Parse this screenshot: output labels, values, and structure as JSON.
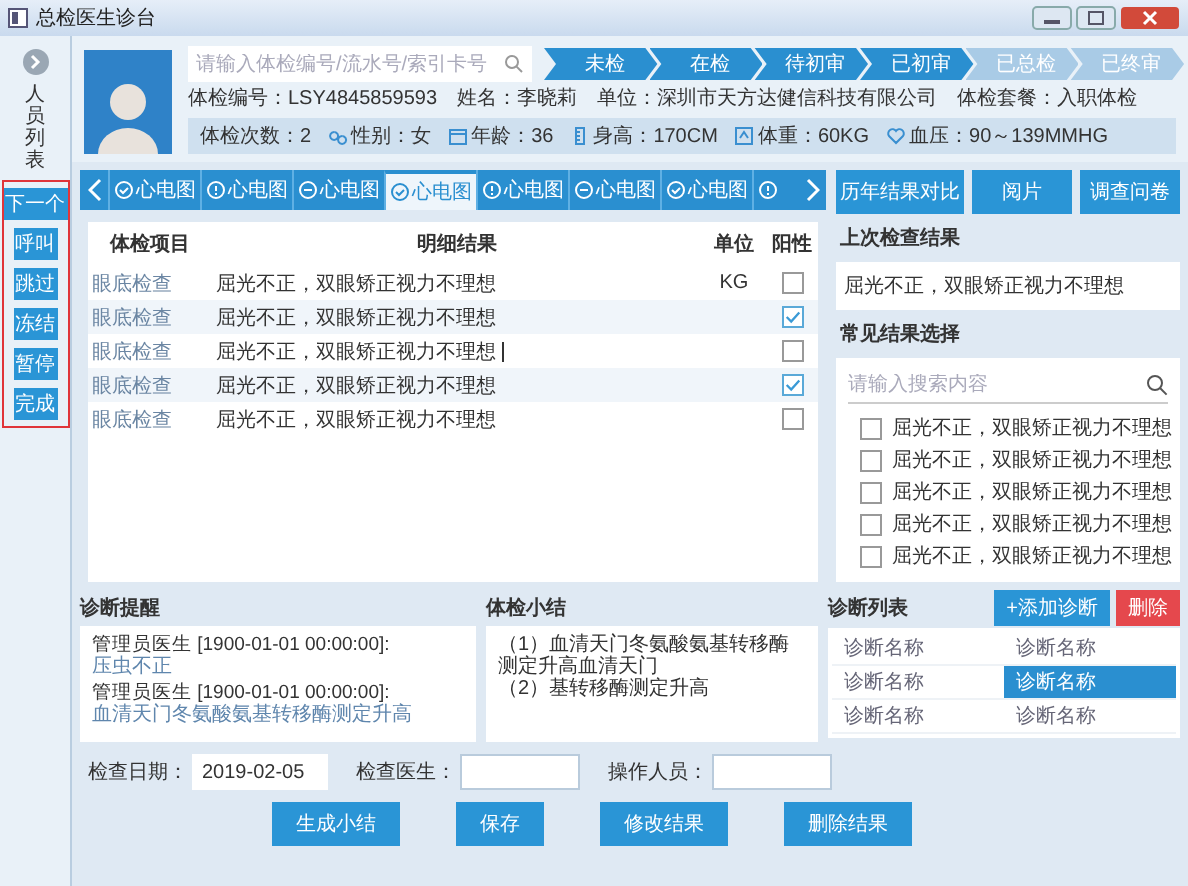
{
  "window": {
    "title": "总检医生诊台"
  },
  "sidebar": {
    "label": "人员列表",
    "actions": [
      "下一个",
      "呼叫",
      "跳过",
      "冻结",
      "暂停",
      "完成"
    ]
  },
  "search": {
    "placeholder": "请输入体检编号/流水号/索引卡号"
  },
  "steps": [
    {
      "label": "未检",
      "done": true
    },
    {
      "label": "在检",
      "done": true
    },
    {
      "label": "待初审",
      "done": true
    },
    {
      "label": "已初审",
      "done": true
    },
    {
      "label": "已总检",
      "done": false
    },
    {
      "label": "已终审",
      "done": false
    }
  ],
  "patient": {
    "info": [
      "体检编号：LSY4845859593",
      "姓名：李晓莉",
      "单位：深圳市天方达健信科技有限公司",
      "体检套餐：入职体检"
    ],
    "stats": [
      "体检次数：2",
      "性别：女",
      "年龄：36",
      "身高：170CM",
      "体重：60KG",
      "血压：90～139MMHG"
    ]
  },
  "tabs": [
    {
      "label": "心电图",
      "kind": "done",
      "selected": false
    },
    {
      "label": "心电图",
      "kind": "info",
      "selected": false
    },
    {
      "label": "心电图",
      "kind": "pending",
      "selected": false
    },
    {
      "label": "心电图",
      "kind": "done",
      "selected": true
    },
    {
      "label": "心电图",
      "kind": "info",
      "selected": false
    },
    {
      "label": "心电图",
      "kind": "pending",
      "selected": false
    },
    {
      "label": "心电图",
      "kind": "done",
      "selected": false
    },
    {
      "kind": "info",
      "selected": false
    }
  ],
  "exam": {
    "columns": [
      "体检项目",
      "明细结果",
      "单位",
      "阳性"
    ],
    "rows": [
      {
        "item": "眼底检查",
        "result": "屈光不正，双眼矫正视力不理想",
        "unit": "KG",
        "positive": false,
        "editing": false
      },
      {
        "item": "眼底检查",
        "result": "屈光不正，双眼矫正视力不理想",
        "positive": true,
        "editing": false
      },
      {
        "item": "眼底检查",
        "result": "屈光不正，双眼矫正视力不理想",
        "positive": false,
        "editing": true
      },
      {
        "item": "眼底检查",
        "result": "屈光不正，双眼矫正视力不理想",
        "positive": true,
        "editing": false
      },
      {
        "item": "眼底检查",
        "result": "屈光不正，双眼矫正视力不理想",
        "positive": false,
        "editing": false
      }
    ]
  },
  "side_buttons": [
    "历年结果对比",
    "阅片",
    "调查问卷"
  ],
  "last_result": {
    "title": "上次检查结果",
    "text": "屈光不正，双眼矫正视力不理想"
  },
  "common_results": {
    "title": "常见结果选择",
    "placeholder": "请输入搜索内容",
    "options": [
      {
        "text": "屈光不正，双眼矫正视力不理想",
        "checked": false
      },
      {
        "text": "屈光不正，双眼矫正视力不理想",
        "checked": false
      },
      {
        "text": "屈光不正，双眼矫正视力不理想",
        "checked": false
      },
      {
        "text": "屈光不正，双眼矫正视力不理想",
        "checked": false
      },
      {
        "text": "屈光不正，双眼矫正视力不理想",
        "checked": false
      }
    ]
  },
  "reminders": {
    "title": "诊断提醒",
    "entries": [
      {
        "author": "管理员医生 [1900-01-01 00:00:00]:",
        "note": "压虫不正"
      },
      {
        "author": "管理员医生 [1900-01-01 00:00:00]:",
        "note": "血清天门冬氨酸氨基转移酶测定升高"
      }
    ]
  },
  "summary": {
    "title": "体检小结",
    "lines": [
      "（1）血清天门冬氨酸氨基转移酶测定升高血清天门",
      "（2）基转移酶测定升高"
    ]
  },
  "diagnoses": {
    "title": "诊断列表",
    "add_button": "+添加诊断",
    "delete_button": "删除",
    "rows": [
      [
        {
          "text": "诊断名称",
          "selected": false
        },
        {
          "text": "诊断名称",
          "selected": false
        }
      ],
      [
        {
          "text": "诊断名称",
          "selected": false
        },
        {
          "text": "诊断名称",
          "selected": true
        }
      ],
      [
        {
          "text": "诊断名称",
          "selected": false
        },
        {
          "text": "诊断名称",
          "selected": false
        }
      ]
    ]
  },
  "footer": {
    "fields": [
      {
        "label": "检查日期：",
        "kind": "date",
        "value": "2019-02-05"
      },
      {
        "label": "检查医生：",
        "kind": "text"
      },
      {
        "label": "操作人员：",
        "kind": "text"
      }
    ],
    "buttons": [
      "生成小结",
      "保存",
      "修改结果",
      "删除结果"
    ]
  }
}
